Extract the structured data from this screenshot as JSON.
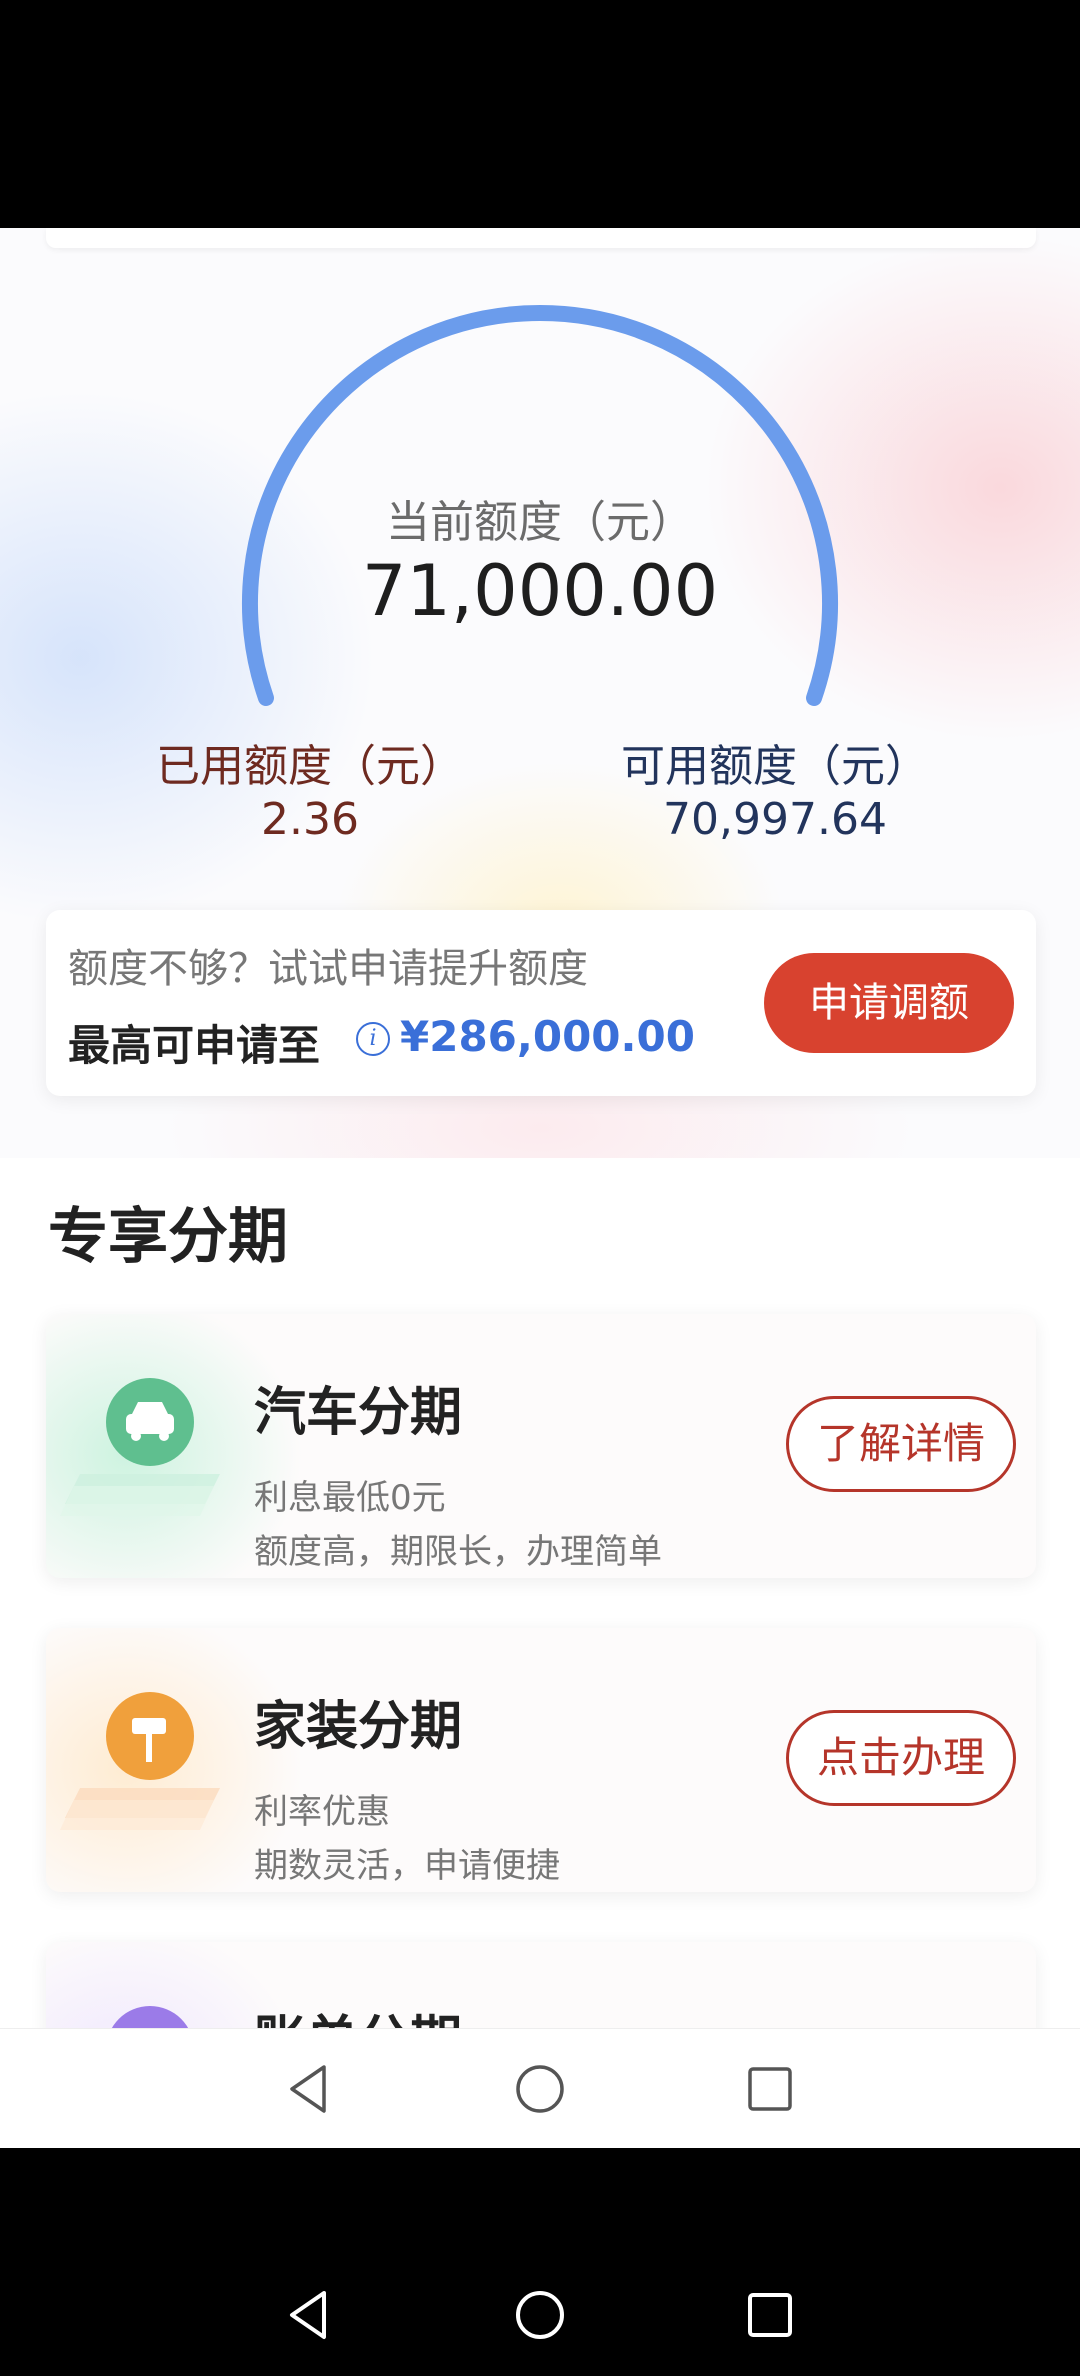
{
  "credit": {
    "current_label": "当前额度（元）",
    "current_value": "71,000.00",
    "used_label": "已用额度（元）",
    "used_value": "2.36",
    "available_label": "可用额度（元）",
    "available_value": "70,997.64"
  },
  "quota_card": {
    "hint": "额度不够？试试申请提升额度",
    "max_label": "最高可申请至",
    "max_amount": "¥286,000.00",
    "apply_button": "申请调额"
  },
  "section": {
    "title": "专享分期"
  },
  "installments": [
    {
      "title": "汽车分期",
      "line1": "利息最低0元",
      "line2": "额度高，期限长，办理简单",
      "button": "了解详情",
      "icon": "car-icon",
      "accent": "#5fbf8f"
    },
    {
      "title": "家装分期",
      "line1": "利率优惠",
      "line2": "期数灵活，申请便捷",
      "button": "点击办理",
      "icon": "paint-roller-icon",
      "accent": "#f0a03c"
    },
    {
      "title": "账单分期",
      "icon": "bill-icon",
      "accent": "#9b7be8"
    }
  ],
  "colors": {
    "gauge_arc": "#6b9cec",
    "apply_button": "#d8422f",
    "link_blue": "#3a6fd8",
    "outline_button": "#b5352a"
  },
  "navigation": [
    "back-icon",
    "home-icon",
    "recents-icon"
  ]
}
